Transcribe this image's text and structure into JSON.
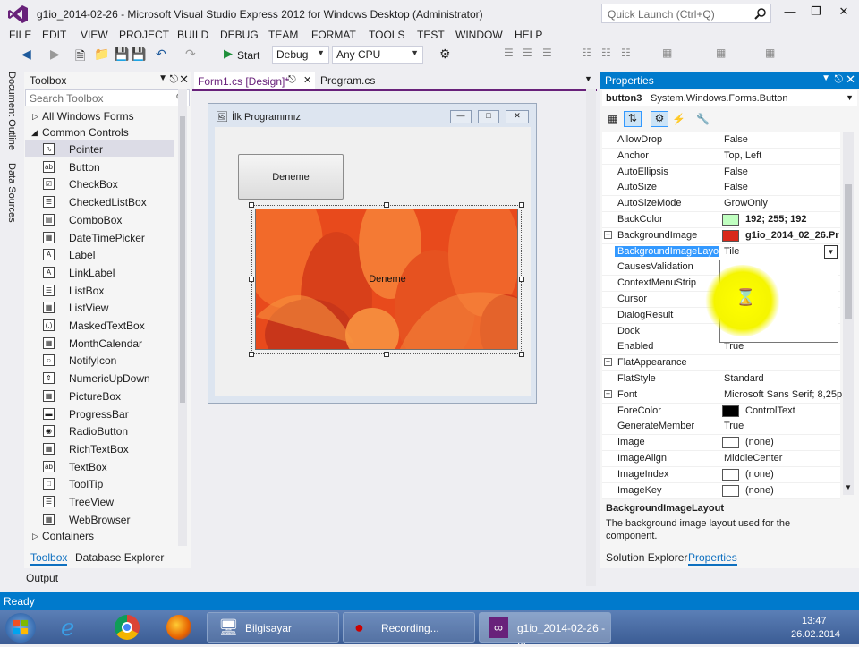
{
  "window": {
    "title": "g1io_2014-02-26 - Microsoft Visual Studio Express 2012 for Windows Desktop (Administrator)",
    "quick_launch": "Quick Launch (Ctrl+Q)"
  },
  "menu": [
    "FILE",
    "EDIT",
    "VIEW",
    "PROJECT",
    "BUILD",
    "DEBUG",
    "TEAM",
    "FORMAT",
    "TOOLS",
    "TEST",
    "WINDOW",
    "HELP"
  ],
  "toolbar": {
    "start": "Start",
    "config": "Debug",
    "platform": "Any CPU"
  },
  "rail": {
    "doc_outline": "Document Outline",
    "data_sources": "Data Sources"
  },
  "toolbox": {
    "title": "Toolbox",
    "search_placeholder": "Search Toolbox",
    "group_all": "All Windows Forms",
    "group_common": "Common Controls",
    "group_containers": "Containers",
    "items": [
      "Pointer",
      "Button",
      "CheckBox",
      "CheckedListBox",
      "ComboBox",
      "DateTimePicker",
      "Label",
      "LinkLabel",
      "ListBox",
      "ListView",
      "MaskedTextBox",
      "MonthCalendar",
      "NotifyIcon",
      "NumericUpDown",
      "PictureBox",
      "ProgressBar",
      "RadioButton",
      "RichTextBox",
      "TextBox",
      "ToolTip",
      "TreeView",
      "WebBrowser"
    ],
    "tab_toolbox": "Toolbox",
    "tab_dbexplorer": "Database Explorer",
    "output": "Output"
  },
  "editor": {
    "tab1": "Form1.cs [Design]*",
    "tab2": "Program.cs",
    "form_title": "İlk Programımız",
    "button1": "Deneme",
    "button3": "Deneme"
  },
  "properties": {
    "title": "Properties",
    "object": "button3",
    "object_type": "System.Windows.Forms.Button",
    "rows": [
      {
        "name": "AllowDrop",
        "value": "False"
      },
      {
        "name": "Anchor",
        "value": "Top, Left"
      },
      {
        "name": "AutoEllipsis",
        "value": "False"
      },
      {
        "name": "AutoSize",
        "value": "False"
      },
      {
        "name": "AutoSizeMode",
        "value": "GrowOnly"
      },
      {
        "name": "BackColor",
        "value": "192; 255; 192",
        "swatch": "#c0ffc0"
      },
      {
        "name": "BackgroundImage",
        "value": "g1io_2014_02_26.Pr",
        "swatch": "#d8281a",
        "expand": true
      },
      {
        "name": "BackgroundImageLayout",
        "value": "Tile",
        "selected": true
      },
      {
        "name": "CausesValidation",
        "value": ""
      },
      {
        "name": "ContextMenuStrip",
        "value": ""
      },
      {
        "name": "Cursor",
        "value": ""
      },
      {
        "name": "DialogResult",
        "value": ""
      },
      {
        "name": "Dock",
        "value": ""
      },
      {
        "name": "Enabled",
        "value": "True"
      },
      {
        "name": "FlatAppearance",
        "value": "",
        "expand": true
      },
      {
        "name": "FlatStyle",
        "value": "Standard"
      },
      {
        "name": "Font",
        "value": "Microsoft Sans Serif; 8,25p",
        "expand": true
      },
      {
        "name": "ForeColor",
        "value": "ControlText",
        "swatch": "#000000"
      },
      {
        "name": "GenerateMember",
        "value": "True"
      },
      {
        "name": "Image",
        "value": "(none)",
        "swatch": "#ffffff"
      },
      {
        "name": "ImageAlign",
        "value": "MiddleCenter"
      },
      {
        "name": "ImageIndex",
        "value": "(none)",
        "swatch": "#ffffff"
      },
      {
        "name": "ImageKey",
        "value": "(none)",
        "swatch": "#ffffff"
      }
    ],
    "desc_title": "BackgroundImageLayout",
    "desc_text": "The background image layout used for the component.",
    "tab_solution": "Solution Explorer",
    "tab_properties": "Properties"
  },
  "status": "Ready",
  "taskbar": {
    "item1": "Bilgisayar",
    "item2": "Recording...",
    "item3": "g1io_2014-02-26 - ...",
    "time": "13:47",
    "date": "26.02.2014"
  }
}
